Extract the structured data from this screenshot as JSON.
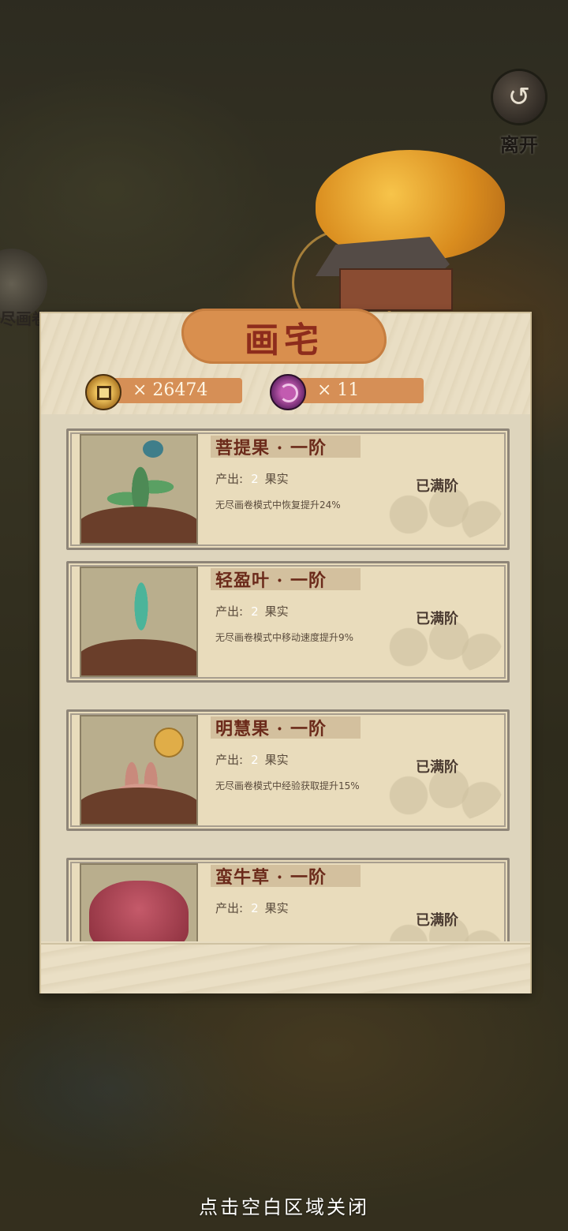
{
  "top": {
    "leave_label": "离开",
    "left_label": "尽画卷"
  },
  "panel": {
    "title": "画宅",
    "currency": [
      {
        "icon": "coin-icon",
        "text": "× 26474"
      },
      {
        "icon": "gem-icon",
        "text": "× 11"
      }
    ]
  },
  "items": [
    {
      "name": "菩提果 · 一阶",
      "output_label": "产出:",
      "output_value": "2",
      "output_unit": "果实",
      "desc": "无尽画卷模式中恢复提升24%",
      "status": "已满阶"
    },
    {
      "name": "轻盈叶 · 一阶",
      "output_label": "产出:",
      "output_value": "2",
      "output_unit": "果实",
      "desc": "无尽画卷模式中移动速度提升9%",
      "status": "已满阶"
    },
    {
      "name": "明慧果 · 一阶",
      "output_label": "产出:",
      "output_value": "2",
      "output_unit": "果实",
      "desc": "无尽画卷模式中经验获取提升15%",
      "status": "已满阶"
    },
    {
      "name": "蛮牛草 · 一阶",
      "output_label": "产出:",
      "output_value": "2",
      "output_unit": "果实",
      "desc": "",
      "status": "已满阶"
    }
  ],
  "footer": {
    "close_hint": "点击空白区域关闭"
  }
}
